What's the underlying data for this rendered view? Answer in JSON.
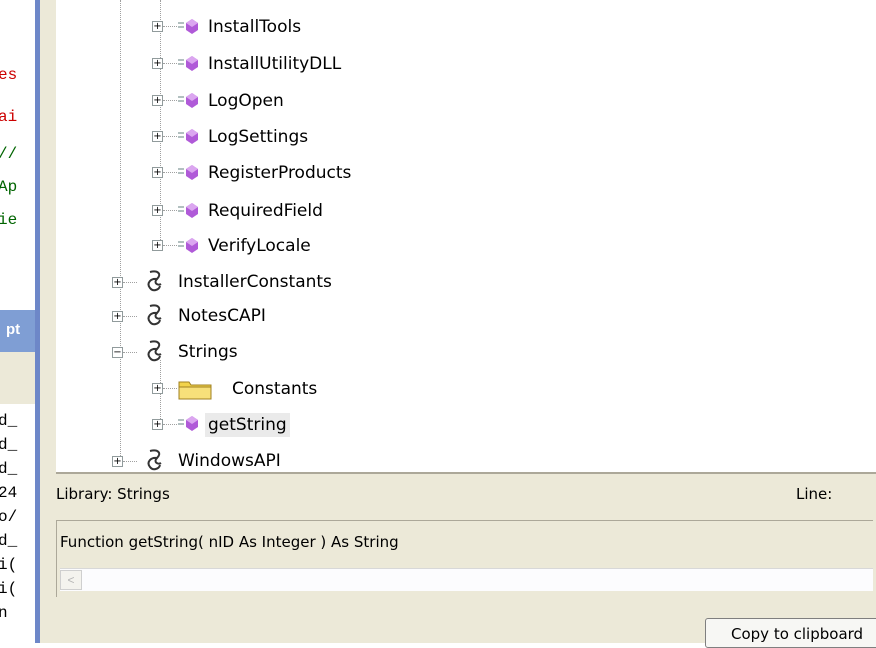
{
  "left_code": {
    "lines": [
      {
        "text": "es",
        "color": "#cc0000"
      },
      {
        "text": "ai",
        "color": "#cc0000"
      },
      {
        "text": "//",
        "color": "#006400"
      },
      {
        "text": "Ap",
        "color": "#006400"
      },
      {
        "text": "ie",
        "color": "#006400"
      }
    ],
    "panel_label": "pt",
    "bottom_lines": [
      "d_",
      "d_",
      "d_",
      "24",
      "o/",
      "d_",
      "i(",
      "i(",
      "n"
    ]
  },
  "tree": {
    "function_items": [
      {
        "label": "InstallTools"
      },
      {
        "label": "InstallUtilityDLL"
      },
      {
        "label": "LogOpen"
      },
      {
        "label": "LogSettings"
      },
      {
        "label": "RegisterProducts"
      },
      {
        "label": "RequiredField"
      },
      {
        "label": "VerifyLocale"
      }
    ],
    "libraries": [
      {
        "label": "InstallerConstants",
        "expander": "+"
      },
      {
        "label": "NotesCAPI",
        "expander": "+"
      },
      {
        "label": "Strings",
        "expander": "−"
      }
    ],
    "strings_children": [
      {
        "label": "Constants",
        "expander": "+",
        "icon": "folder-icon"
      },
      {
        "label": "getString",
        "expander": "+",
        "icon": "function-icon",
        "selected": true
      }
    ],
    "last_library": {
      "label": "WindowsAPI",
      "expander": "+"
    }
  },
  "status": {
    "library_text": "Library:  Strings",
    "line_label": "Line:",
    "signature": "Function getString( nID As Integer ) As String",
    "scroll_left_glyph": "<",
    "copy_button": "Copy to clipboard"
  },
  "colors": {
    "divider": "#6d87c8",
    "panel_bg": "#ece9d8",
    "function_icon": "#b05ad8",
    "folder_icon": "#f2d34b"
  }
}
